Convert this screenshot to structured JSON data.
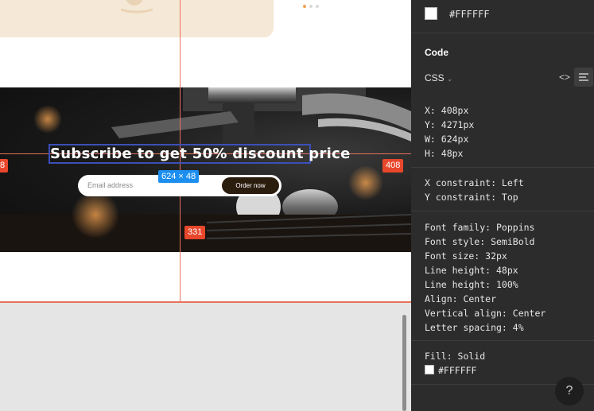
{
  "canvas": {
    "headline": "Subscribe to get 50% discount price",
    "email_placeholder": "Email address",
    "order_button": "Order now",
    "size_label": "624 × 48",
    "spacing_left": "8",
    "spacing_right": "408",
    "spacing_bottom": "331",
    "guide_color": "#E8725A",
    "selection_color": "#1C8EF0"
  },
  "inspector": {
    "fill_hex_top": "#FFFFFF",
    "code_title": "Code",
    "language": "CSS",
    "position": {
      "x": "X: 408px",
      "y": "Y: 4271px",
      "w": "W: 624px",
      "h": "H: 48px"
    },
    "constraints": {
      "x": "X constraint: Left",
      "y": "Y constraint: Top"
    },
    "typography": {
      "family": "Font family: Poppins",
      "style": "Font style: SemiBold",
      "size": "Font size: 32px",
      "line_height_px": "Line height: 48px",
      "line_height_pct": "Line height: 100%",
      "align": "Align: Center",
      "vertical_align": "Vertical align: Center",
      "letter_spacing": "Letter spacing: 4%"
    },
    "fill": {
      "label": "Fill: Solid",
      "hex": "#FFFFFF"
    },
    "help": "?"
  }
}
